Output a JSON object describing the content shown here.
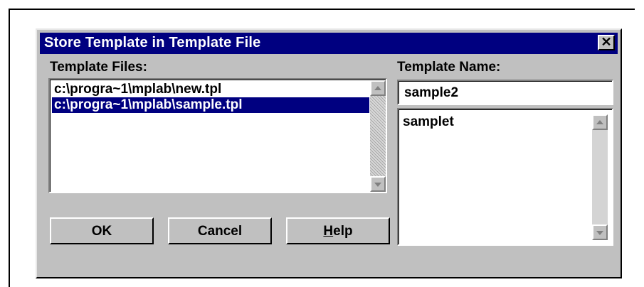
{
  "dialog": {
    "title": "Store Template in Template File",
    "close_label": "✕"
  },
  "template_files": {
    "label": "Template Files:",
    "items": [
      {
        "text": "c:\\progra~1\\mplab\\new.tpl",
        "selected": false
      },
      {
        "text": "c:\\progra~1\\mplab\\sample.tpl",
        "selected": true
      }
    ]
  },
  "template_name": {
    "label": "Template Name:",
    "value": "sample2",
    "items": [
      "samplet"
    ]
  },
  "buttons": {
    "ok": "OK",
    "cancel": "Cancel",
    "help_hotkey": "H",
    "help_rest": "elp"
  },
  "icons": {
    "close": "close-icon",
    "scroll_up": "scroll-up-arrow-icon",
    "scroll_down": "scroll-down-arrow-icon"
  },
  "colors": {
    "titlebar": "#000080",
    "selection": "#000080",
    "face": "#c0c0c0"
  }
}
